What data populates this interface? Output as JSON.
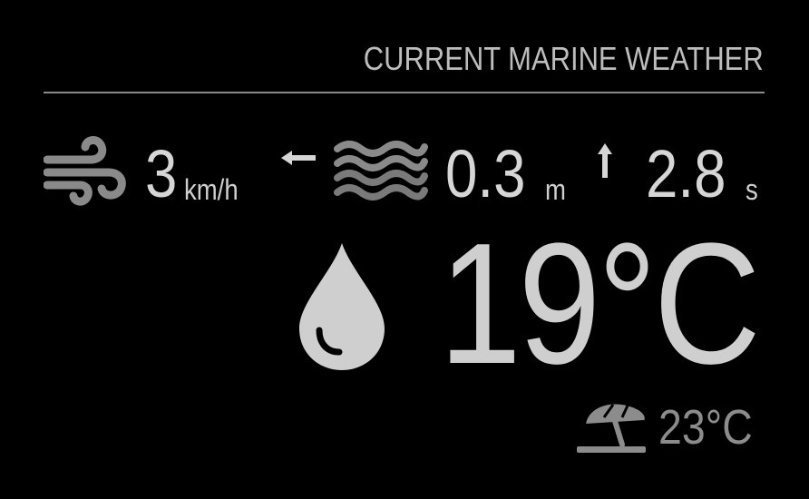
{
  "header": {
    "title": "CURRENT MARINE WEATHER"
  },
  "wind": {
    "icon": "wind-icon",
    "speed": "3",
    "unit": "km/h",
    "direction_icon": "arrow-left-icon"
  },
  "waves": {
    "icon": "waves-icon",
    "height": "0.3",
    "height_unit": "m",
    "direction_icon": "arrow-up-icon",
    "period": "2.8",
    "period_unit": "s"
  },
  "water": {
    "icon": "water-drop-icon",
    "temperature": "19°C"
  },
  "air": {
    "icon": "beach-umbrella-icon",
    "temperature": "23°C"
  },
  "colors": {
    "background": "#000000",
    "primary_text": "#d6d6d6",
    "secondary_text": "#8c8c8c",
    "icon_gray": "#8a8a8a",
    "drop": "#cfcfcf"
  }
}
